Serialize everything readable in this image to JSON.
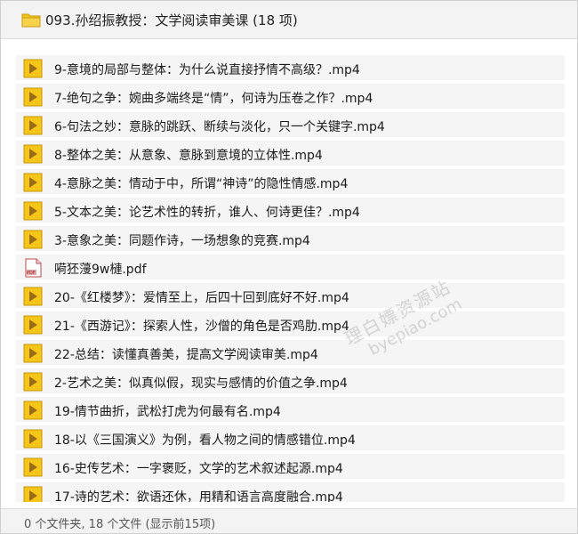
{
  "window": {
    "title": "093.孙绍振教授：文学阅读审美课 (18 项)"
  },
  "files": [
    {
      "name": "9-意境的局部与整体：为什么说直接抒情不高级？.mp4",
      "icon": "video-file-icon"
    },
    {
      "name": "7-绝句之争：婉曲多端终是“情”，何诗为压卷之作？.mp4",
      "icon": "video-file-icon"
    },
    {
      "name": "6-句法之妙：意脉的跳跃、断续与淡化，只一个关键字.mp4",
      "icon": "video-file-icon"
    },
    {
      "name": "8-整体之美：从意象、意脉到意境的立体性.mp4",
      "icon": "video-file-icon"
    },
    {
      "name": "4-意脉之美：情动于中，所谓“神诗”的隐性情感.mp4",
      "icon": "video-file-icon"
    },
    {
      "name": "5-文本之美：论艺术性的转折，谁人、何诗更佳？.mp4",
      "icon": "video-file-icon"
    },
    {
      "name": "3-意象之美：同题作诗，一场想象的竞赛.mp4",
      "icon": "video-file-icon"
    },
    {
      "name": "嗬狉薓9w槤.pdf",
      "icon": "pdf-file-icon"
    },
    {
      "name": "20-《红楼梦》：爱情至上，后四十回到底好不好.mp4",
      "icon": "video-file-icon"
    },
    {
      "name": "21-《西游记》：探索人性，沙僧的角色是否鸡肋.mp4",
      "icon": "video-file-icon"
    },
    {
      "name": "22-总结：读懂真善美，提高文学阅读审美.mp4",
      "icon": "video-file-icon"
    },
    {
      "name": "2-艺术之美：似真似假，现实与感情的价值之争.mp4",
      "icon": "video-file-icon"
    },
    {
      "name": "19-情节曲折，武松打虎为何最有名.mp4",
      "icon": "video-file-icon"
    },
    {
      "name": "18-以《三国演义》为例，看人物之间的情感错位.mp4",
      "icon": "video-file-icon"
    },
    {
      "name": "16-史传艺术：一字褒贬，文学的艺术叙述起源.mp4",
      "icon": "video-file-icon"
    },
    {
      "name": "17-诗的艺术：欲语还休，用精和语言高度融合.mp4",
      "icon": "video-file-icon"
    }
  ],
  "status_bar": {
    "text": "0 个文件夹, 18 个文件 (显示前15项)"
  },
  "watermark": {
    "line1": "理白嫖资源站",
    "line2": "byepiao.com"
  },
  "colors": {
    "folder": "#f2c21a",
    "video_icon": "#f5c518",
    "video_play": "#9a6a14",
    "row_bg": "#f5f5f5",
    "header_bg": "#f3f3f3"
  }
}
